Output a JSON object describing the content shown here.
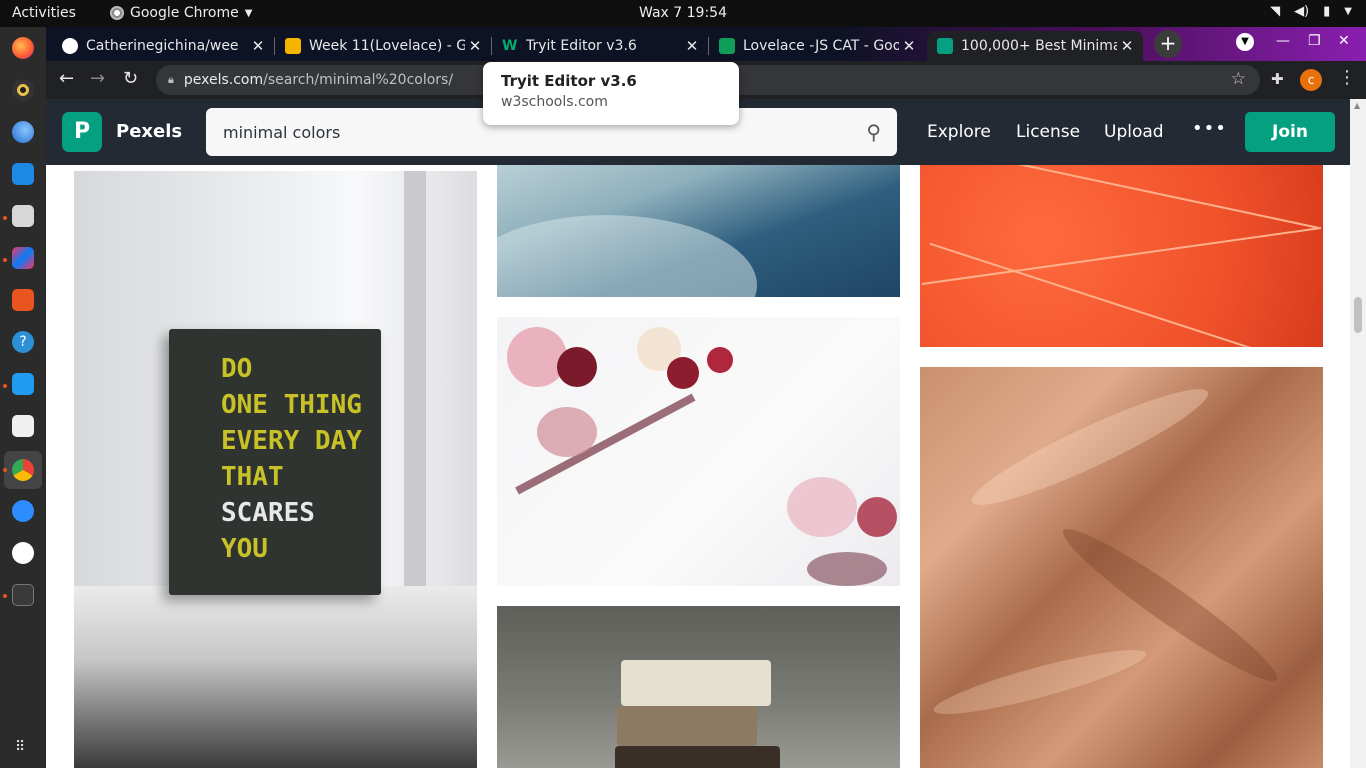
{
  "topbar": {
    "activities": "Activities",
    "app_name": "Google Chrome",
    "clock": "Wax 7  19:54"
  },
  "tabs": [
    {
      "title": "Catherinegichina/wee",
      "favicon": "github-icon",
      "active": false
    },
    {
      "title": "Week 11(Lovelace) - Go",
      "favicon": "slides-icon",
      "active": false
    },
    {
      "title": "Tryit Editor v3.6",
      "favicon": "w3schools-icon",
      "active": false
    },
    {
      "title": "Lovelace -JS CAT - Goo",
      "favicon": "sheets-icon",
      "active": false
    },
    {
      "title": "100,000+ Best Minimal",
      "favicon": "pexels-icon",
      "active": true
    }
  ],
  "omnibox": {
    "host": "pexels.com",
    "path": "/search/minimal%20colors/"
  },
  "profile_initial": "c",
  "tooltip": {
    "title": "Tryit Editor v3.6",
    "domain": "w3schools.com"
  },
  "pexels": {
    "logo_letter": "P",
    "brand": "Pexels",
    "search_value": "minimal colors",
    "nav": [
      "Explore",
      "License",
      "Upload"
    ],
    "more": "•••",
    "join": "Join"
  },
  "book": {
    "lines": [
      "DO",
      "ONE THING",
      "EVERY DAY",
      "THAT",
      "SCARES",
      "YOU"
    ]
  },
  "colors": {
    "pexels_green": "#05a081",
    "pexels_header": "#232a34",
    "accent_orange": "#e95420"
  }
}
